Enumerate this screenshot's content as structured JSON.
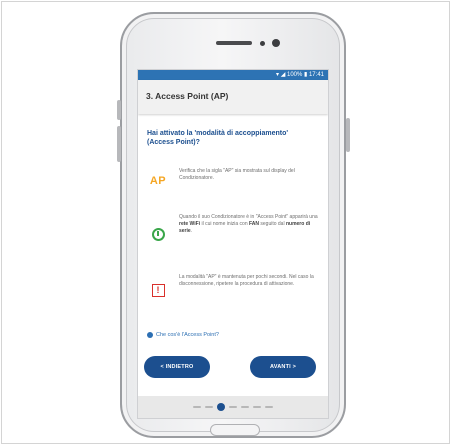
{
  "status": {
    "text": "▾ ◢ 100% ▮ 17:41"
  },
  "appbar": {
    "title": "3. Access Point (AP)"
  },
  "content": {
    "question": "Hai attivato la 'modalità di accoppiamento' (Access Point)?",
    "items": [
      {
        "icon": "ap-icon",
        "icon_text": "AP",
        "text_parts": [
          "Verifica che la sigla \"AP\" sia mostrata sul display del Condizionatore."
        ]
      },
      {
        "icon": "power-icon",
        "text_parts": [
          "Quando il suo Condizionatore è in \"Access Point\" apparirà una ",
          "rete WiFi",
          " il cui nome inizia con ",
          "FAN",
          " seguito dal ",
          "numero di serie",
          "."
        ]
      },
      {
        "icon": "warning-icon",
        "icon_text": "!",
        "text_parts": [
          "La modalità \"AP\" è mantenuta per pochi secondi. Nel caso la disconnessione, ripetere la procedura di attivazione."
        ]
      }
    ],
    "help_link": "Che cos'è l'Access Point?"
  },
  "buttons": {
    "back": "< INDIETRO",
    "next": "AVANTI >"
  },
  "pager": {
    "total_steps": 7,
    "active_step": 3
  }
}
